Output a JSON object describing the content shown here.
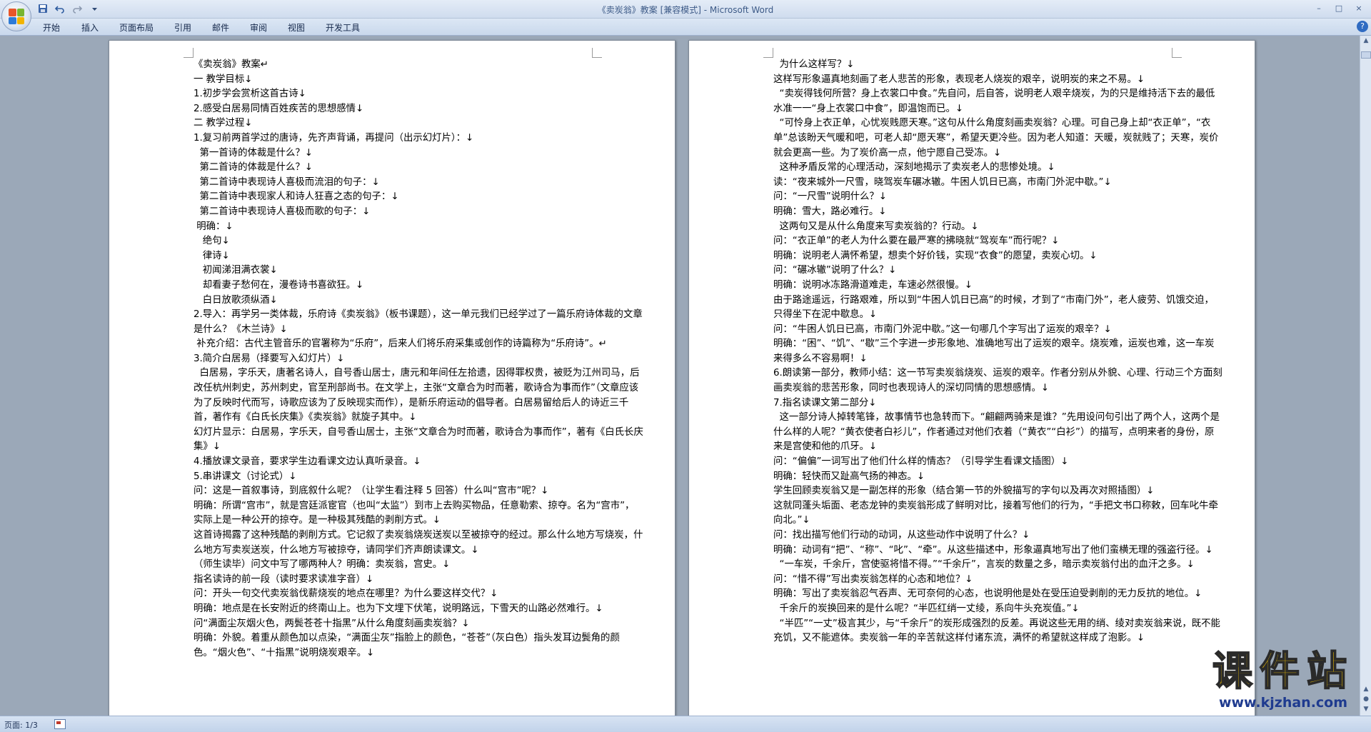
{
  "window": {
    "title": "《卖炭翁》教案 [兼容模式] - Microsoft Word",
    "controls": [
      "–",
      "□",
      "×"
    ]
  },
  "quick_access": {
    "save_icon": "save-icon",
    "undo_icon": "undo-icon",
    "redo_icon": "redo-icon",
    "customize_icon": "dropdown-icon"
  },
  "ribbon": {
    "tabs": [
      "开始",
      "插入",
      "页面布局",
      "引用",
      "邮件",
      "审阅",
      "视图",
      "开发工具"
    ],
    "help": "?"
  },
  "pages": [
    {
      "paragraphs": [
        "《卖炭翁》教案↵",
        "一 教学目标↓",
        "1.初步学会赏析这首古诗↓",
        "2.感受白居易同情百姓疾苦的思想感情↓",
        "二 教学过程↓",
        "1.复习前两首学过的唐诗，先齐声背诵，再提问（出示幻灯片）：↓",
        "  第一首诗的体裁是什么？↓",
        "  第二首诗的体裁是什么？↓",
        "  第二首诗中表现诗人喜极而流泪的句子：↓",
        "  第二首诗中表现家人和诗人狂喜之态的句子：↓",
        "  第二首诗中表现诗人喜极而歌的句子：↓",
        " 明确：↓",
        "   绝句↓",
        "   律诗↓",
        "   初闻涕泪满衣裳↓",
        "   却看妻子愁何在，漫卷诗书喜欲狂。↓",
        "   白日放歌须纵酒↓",
        "2.导入：再学另一类体裁，乐府诗《卖炭翁》（板书课题），这一单元我们已经学过了一篇乐府诗体裁的文章是什么？《木兰诗》↓",
        " 补充介绍：古代主管音乐的官署称为“乐府”，后来人们将乐府采集或创作的诗篇称为“乐府诗”。↵",
        "3.简介白居易（择要写入幻灯片）↓",
        "  白居易，字乐天，唐著名诗人，自号香山居士，唐元和年间任左拾遗，因得罪权贵，被贬为江州司马，后改任杭州刺史，苏州刺史，官至刑部尚书。在文学上，主张“文章合为时而著，歌诗合为事而作”（文章应该为了反映时代而写，诗歌应该为了反映现实而作），是新乐府运动的倡导者。白居易留给后人的诗近三千首，著作有《白氏长庆集》《卖炭翁》就旋子其中。↓",
        "幻灯片显示：白居易，字乐天，自号香山居士，主张“文章合为时而著，歌诗合为事而作”，著有《白氏长庆集》↓",
        "4.播放课文录音，要求学生边看课文边认真听录音。↓",
        "5.串讲课文（讨论式）↓",
        "问：这是一首叙事诗，到底叙什么呢？（让学生看注释 5 回答）什么叫“宫市”呢？↓",
        "明确：所谓“宫市”，就是宫廷派宦官（也叫“太监”）到市上去购买物品，任意勒索、掠夺。名为“宫市”，实际上是一种公开的掠夺。是一种极其残酷的剥削方式。↓",
        "这首诗揭露了这种残酷的剥削方式。它记叙了卖炭翁烧炭送炭以至被掠夺的经过。那么什么地方写烧炭，什么地方写卖炭送炭，什么地方写被掠夺，请同学们齐声朗读课文。↓",
        "（师生读毕）问文中写了哪两种人？明确：卖炭翁，宫史。↓",
        "指名读诗的前一段（读时要求读准字音）↓",
        "问：开头一句交代卖炭翁伐薪烧炭的地点在哪里？为什么要这样交代？↓",
        "明确：地点是在长安附近的终南山上。也为下文埋下伏笔，说明路远，下雪天的山路必然难行。↓",
        "问“满面尘灰烟火色，两鬓苍苍十指黑”从什么角度刻画卖炭翁？↓",
        "明确：外貌。着重从颜色加以点染，“满面尘灰”指脸上的颜色，“苍苍”（灰白色）指头发耳边鬓角的颜色。“烟火色”、“十指黑”说明烧炭艰辛。↓"
      ]
    },
    {
      "paragraphs": [
        "  为什么这样写？↓",
        "这样写形象逼真地刻画了老人悲苦的形象，表现老人烧炭的艰辛，说明炭的来之不易。↓",
        "  “卖炭得钱何所营？身上衣裳口中食。”先自问，后自答，说明老人艰辛烧炭，为的只是维持活下去的最低水准一一“身上衣裳口中食”，即温饱而已。↓",
        "  “可怜身上衣正单，心忧炭贱愿天寒。”这句从什么角度刻画卖炭翁？心理。可自己身上却“衣正单”，“衣单”总该盼天气暖和吧，可老人却“愿天寒”，希望天更冷些。因为老人知道：天暖，炭就贱了；天寒，炭价就会更高一些。为了炭价高一点，他宁愿自己受冻。↓",
        "  这种矛盾反常的心理活动，深刻地揭示了卖炭老人的悲惨处境。↓",
        "读：“夜来城外一尺雪，晓驾炭车碾冰辙。牛困人饥日已高，市南门外泥中歇。”↓",
        "问：“一尺雪”说明什么？↓",
        "明确：雪大，路必难行。↓",
        "  这两句又是从什么角度来写卖炭翁的？行动。↓",
        "问：“衣正单”的老人为什么要在最严寒的拂晓就“驾炭车”而行呢？↓",
        "明确：说明老人满怀希望，想卖个好价钱，实现“衣食”的愿望，卖炭心切。↓",
        "问：“碾冰辙”说明了什么？↓",
        "明确：说明冰冻路滑道难走，车速必然很慢。↓",
        "由于路途遥远，行路艰难，所以到“牛困人饥日已高”的时候，才到了“市南门外”，老人疲劳、饥饿交迫，只得坐下在泥中歇息。↓",
        "问：“牛困人饥日已高，市南门外泥中歇。”这一句哪几个字写出了运炭的艰辛？↓",
        "明确：“困”、“饥”、“歇”三个字进一步形象地、准确地写出了运炭的艰辛。烧炭难，运炭也难，这一车炭来得多么不容易啊！↓",
        "6.朗读第一部分，教师小结：这一节写卖炭翁烧炭、运炭的艰辛。作者分别从外貌、心理、行动三个方面刻画卖炭翁的悲苦形象，同时也表现诗人的深切同情的思想感情。↓",
        "7.指名读课文第二部分↓",
        "  这一部分诗人掉转笔锋，故事情节也急转而下。“翩翩两骑来是谁？”先用设问句引出了两个人，这两个是什么样的人呢？“黄衣使者白衫儿”，作者通过对他们衣着（“黄衣”“白衫”）的描写，点明来者的身份，原来是宫使和他的爪牙。↓",
        "问：“偏偏”一词写出了他们什么样的情态？（引导学生看课文插图）↓",
        "明确：轻快而又趾高气扬的神态。↓",
        "学生回顾卖炭翁又是一副怎样的形象（结合第一节的外貌描写的字句以及再次对照插图）↓",
        "这就同蓬头垢面、老态龙钟的卖炭翁形成了鲜明对比，接着写他们的行为，“手把文书口称敕，回车叱牛牵向北。”↓",
        "问：找出描写他们行动的动词，从这些动作中说明了什么？↓",
        "明确：动词有“把”、“称”、“叱”、“牵”。从这些描述中，形象逼真地写出了他们蛮横无理的强盗行径。↓",
        "  “一车炭，千余斤，宫使驱将惜不得。”“千余斤”，言炭的数量之多，暗示卖炭翁付出的血汗之多。↓",
        "问：“惜不得”写出卖炭翁怎样的心态和地位？↓",
        "明确：写出了卖炭翁忍气吞声、无可奈何的心态，也说明他是处在受压迫受剥削的无力反抗的地位。↓",
        "  千余斤的炭换回来的是什么呢？“半匹红绡一丈绫，系向牛头充炭值。”↓",
        "  “半匹”“一丈”极言其少，与“千余斤”的炭形成强烈的反差。再说这些无用的绡、绫对卖炭翁来说，既不能充饥，又不能遮体。卖炭翁一年的辛苦就这样付诸东流，满怀的希望就这样成了泡影。↓"
      ]
    }
  ],
  "status": {
    "page_info": "页面: 1/3"
  },
  "watermark": {
    "title": "课件站",
    "url": "www.kjzhan.com"
  }
}
